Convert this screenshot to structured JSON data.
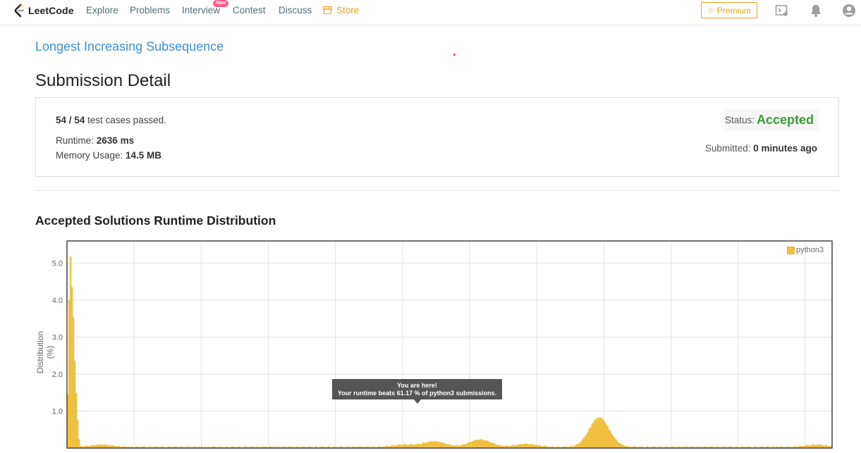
{
  "nav": {
    "brand": "LeetCode",
    "items": [
      {
        "label": "Explore"
      },
      {
        "label": "Problems"
      },
      {
        "label": "Interview"
      },
      {
        "label": "Contest"
      },
      {
        "label": "Discuss"
      },
      {
        "label": "Store"
      }
    ],
    "new_badge": "New",
    "premium": "Premium",
    "icons": [
      "debugger-icon",
      "bell-icon",
      "user-avatar-icon"
    ]
  },
  "problem": {
    "title": "Longest Increasing Subsequence"
  },
  "page": {
    "title": "Submission Detail"
  },
  "submission": {
    "passed": "54 / 54",
    "passed_suffix": " test cases passed.",
    "runtime_label": "Runtime: ",
    "runtime_value": "2636 ms",
    "memory_label": "Memory Usage: ",
    "memory_value": "14.5 MB",
    "status_label": "Status:",
    "status_value": "Accepted",
    "submitted_label": "Submitted: ",
    "submitted_value": "0 minutes ago"
  },
  "section": {
    "title": "Accepted Solutions Runtime Distribution"
  },
  "tooltip": {
    "line1": "You are here!",
    "line2": "Your runtime beats 61.17 % of python3 submissions."
  },
  "colors": {
    "accent": "#3f8fd8",
    "accepted": "#3c9c38",
    "premium": "#f0a020",
    "bar": "#f0c040"
  },
  "chart_data": {
    "type": "bar",
    "ylabel": "Distribution (%)",
    "xlabel": "",
    "yticks": [
      "1.0",
      "2.0",
      "3.0",
      "4.0",
      "5.0"
    ],
    "ylim": [
      0,
      5.6
    ],
    "grid": true,
    "legend": "top-right",
    "series": [
      {
        "name": "python3",
        "peaks": [
          {
            "x": 0.004,
            "y": 4.7
          },
          {
            "x": 0.008,
            "y": 2.9
          },
          {
            "x": 0.012,
            "y": 1.1
          },
          {
            "x": 0.045,
            "y": 0.06
          },
          {
            "x": 0.44,
            "y": 0.06
          },
          {
            "x": 0.48,
            "y": 0.15
          },
          {
            "x": 0.54,
            "y": 0.2
          },
          {
            "x": 0.6,
            "y": 0.08
          },
          {
            "x": 0.7,
            "y": 0.1
          },
          {
            "x": 0.695,
            "y": 0.7
          },
          {
            "x": 0.98,
            "y": 0.06
          }
        ]
      }
    ]
  }
}
